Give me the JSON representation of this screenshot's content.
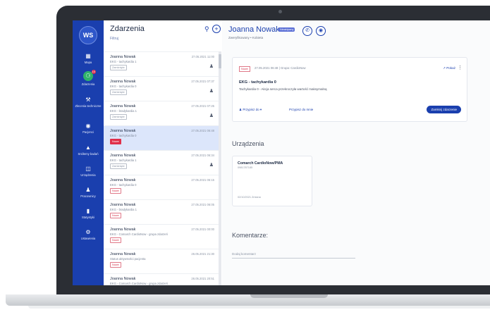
{
  "nav": {
    "avatar": "WS",
    "items": [
      {
        "label": "Mapa",
        "icon": "map-icon"
      },
      {
        "label": "Zdarzenia",
        "icon": "bell-icon",
        "badge": "10"
      },
      {
        "label": "Zlecenia techniczne",
        "icon": "wrench-icon"
      },
      {
        "label": "Pacjenci",
        "icon": "patient-icon"
      },
      {
        "label": "Snółemy badań",
        "icon": "tree-icon"
      },
      {
        "label": "Urządzenia",
        "icon": "device-icon"
      },
      {
        "label": "Pracownicy",
        "icon": "people-icon"
      },
      {
        "label": "Statystyki",
        "icon": "chart-icon"
      },
      {
        "label": "Ustawienia",
        "icon": "gear-icon"
      }
    ]
  },
  "list": {
    "title": "Zdarzenia",
    "filter": "Filtruj",
    "rows": [
      {
        "name": "Joanna Nowak",
        "desc": "EKG - tachykardia 1",
        "date": "27.05.2021 11:00",
        "tag": "Zamknięte",
        "tagType": "closed",
        "person": true
      },
      {
        "name": "Joanna Nowak",
        "desc": "EKG - tachykardia 0",
        "date": "27.05.2021 07:37",
        "tag": "Zamknięte",
        "tagType": "closed",
        "person": true
      },
      {
        "name": "Joanna Nowak",
        "desc": "EKG - bradykardia 1",
        "date": "27.05.2021 07:25",
        "tag": "Zamknięte",
        "tagType": "closed",
        "person": true
      },
      {
        "name": "Joanna Nowak",
        "desc": "EKG - tachykardia 0",
        "date": "27.05.2021 06:48",
        "tag": "Nowe",
        "tagType": "newsel",
        "person": false,
        "selected": true
      },
      {
        "name": "Joanna Nowak",
        "desc": "EKG - tachykardia 1",
        "date": "27.05.2021 06:34",
        "tag": "Zamknięte",
        "tagType": "closed",
        "person": true
      },
      {
        "name": "Joanna Nowak",
        "desc": "EKG - tachykardia 0",
        "date": "27.05.2021 06:15",
        "tag": "Nowe",
        "tagType": "new",
        "person": false
      },
      {
        "name": "Joanna Nowak",
        "desc": "EKG - bradykardia 1",
        "date": "27.05.2021 06:05",
        "tag": "Nowe",
        "tagType": "new",
        "person": false
      },
      {
        "name": "Joanna Nowak",
        "desc": "EKG - Comarch CardioNow - grupa zdarzeń",
        "date": "27.05.2021 00:00",
        "tag": "Nowe",
        "tagType": "new",
        "person": false
      },
      {
        "name": "Joanna Nowak",
        "desc": "Status aktywności pacjenta",
        "date": "26.05.2021 21:30",
        "tag": "Nowe",
        "tagType": "new",
        "person": false
      },
      {
        "name": "Joanna Nowak",
        "desc": "EKG - Comarch CardioNow - grupa zdarzeń",
        "date": "26.05.2021 20:51",
        "tag": "",
        "tagType": "none",
        "person": false
      }
    ]
  },
  "detail": {
    "patient_name": "Joanna Nowak",
    "patient_badge": "Nieaktywny",
    "patient_status": "Zweryfikowany • Kobieta",
    "event": {
      "tag": "Nowe",
      "meta": "27.05.2021 06:48  |  Grupa: CardioNow",
      "title": "EKG - tachykardia 0",
      "text": "Tachykardia 0 - Akcja serca przekroczyła wartość maksymalną",
      "preview": "Pokaż",
      "assign": "Przypisz do",
      "assign_me": "Przypisz do mnie",
      "close": "Zamknij zdarzenie"
    },
    "devices_title": "Urządzenia",
    "device": {
      "name": "Comarch CardioNow/PMA",
      "serial": "0981787185",
      "date": "02/10/2021 Zmiana"
    },
    "comments_title": "Komentarze:",
    "comment_placeholder": "Dodaj komentarz"
  }
}
